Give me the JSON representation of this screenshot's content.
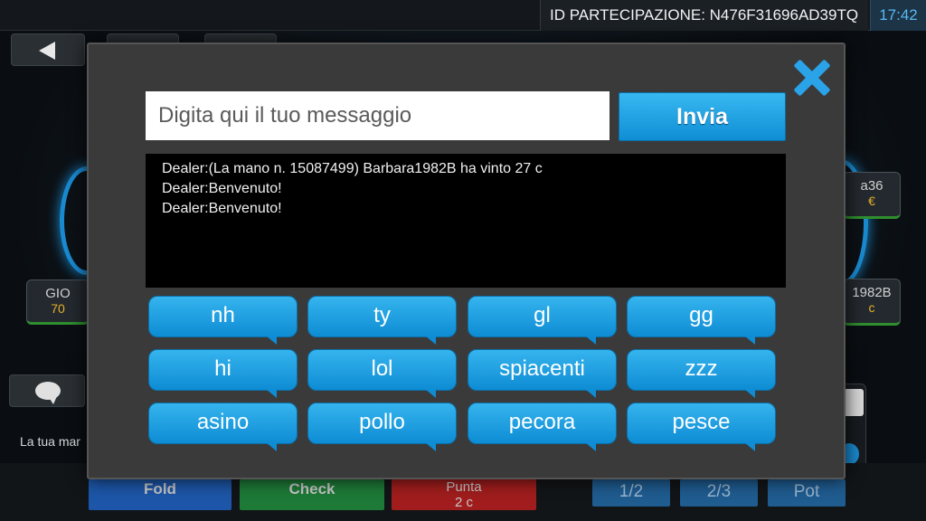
{
  "status_bar": {
    "participation_id": "ID PARTECIPAZIONE: N476F31696AD39TQ",
    "time": "17:42"
  },
  "table": {
    "seat_left": {
      "name": "GIO",
      "amount": "70"
    },
    "seat_right_top": {
      "name": "a36",
      "amount": "€"
    },
    "seat_right_bottom": {
      "name": "1982B",
      "amount": "c"
    },
    "hand_text": "La tua mar"
  },
  "actions": {
    "fold": "Fold",
    "check": "Check",
    "raise_label": "Punta",
    "raise_amount": "2 c",
    "half": "1/2",
    "two_thirds": "2/3",
    "pot": "Pot"
  },
  "chat": {
    "input_placeholder": "Digita qui il tuo messaggio",
    "send_label": "Invia",
    "messages": [
      "Dealer:(La mano n. 15087499) Barbara1982B ha vinto 27 c",
      "Dealer:Benvenuto!",
      "Dealer:Benvenuto!"
    ],
    "quick_phrases": [
      "nh",
      "ty",
      "gl",
      "gg",
      "hi",
      "lol",
      "spiacenti",
      "zzz",
      "asino",
      "pollo",
      "pecora",
      "pesce"
    ]
  },
  "colors": {
    "accent_blue": "#1a9ee2",
    "modal_bg": "#3a3a3a",
    "fold_blue": "#1d56a8",
    "check_green": "#1d7a37",
    "raise_red": "#a11d1d"
  }
}
